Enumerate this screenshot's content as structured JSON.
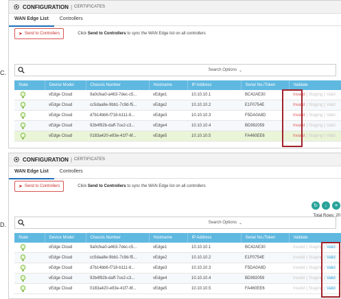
{
  "options": {
    "c": "C.",
    "d": "D."
  },
  "header": {
    "title": "CONFIGURATION",
    "separator": "|",
    "section": "CERTIFICATES"
  },
  "tabs": [
    {
      "label": "WAN Edge List",
      "active": true
    },
    {
      "label": "Controllers",
      "active": false
    }
  ],
  "send": {
    "button": "Send to Controllers",
    "msg_prefix": "Click",
    "msg_bold": "Send to Controllers",
    "msg_suffix": "to sync the WAN Edge list on all controllers"
  },
  "search": {
    "options_label": "Search Options"
  },
  "total_rows": "Total Rows: 20",
  "columns": [
    "State",
    "Device Model",
    "Chassis Number",
    "Hostname",
    "IP Address",
    "Serial No./Token",
    "Validate"
  ],
  "rows": [
    {
      "model": "vEdge Cloud",
      "chassis": "9a0cfea0-a463-7dec-c5...",
      "host": "vEdge1",
      "ip": "10.10.10.1",
      "serial": "BC42AE30"
    },
    {
      "model": "vEdge Cloud",
      "chassis": "cc5daa8e-9bb1-7c9d-f5...",
      "host": "vEdge2",
      "ip": "10.10.10.2",
      "serial": "E1F0754E"
    },
    {
      "model": "vEdge Cloud",
      "chassis": "d7b14bb6-f718-b111-8...",
      "host": "vEdge3",
      "ip": "10.10.10.3",
      "serial": "F5DA0A8D"
    },
    {
      "model": "vEdge Cloud",
      "chassis": "92b4f92b-daff-7ce2-c3...",
      "host": "vEdge4",
      "ip": "10.10.10.4",
      "serial": "BD992059"
    },
    {
      "model": "vEdge Cloud",
      "chassis": "0183a420-e93e-41f7-6f...",
      "host": "vEdge5",
      "ip": "10.10.10.5",
      "serial": "FA460EE6"
    }
  ],
  "validate": {
    "invalid": "Invalid",
    "staging": "Staging",
    "valid": "Valid",
    "sep": "|"
  },
  "colors": {
    "header_bg": "#5fb8e0",
    "highlight": "#a0202a",
    "invalid": "#e05a5a",
    "accent": "#1d6fb8"
  },
  "icons": {
    "gear": "gear-icon",
    "search": "search-icon",
    "bulb": "lightbulb-icon",
    "actions": [
      "refresh-icon",
      "download-icon",
      "menu-icon"
    ]
  }
}
